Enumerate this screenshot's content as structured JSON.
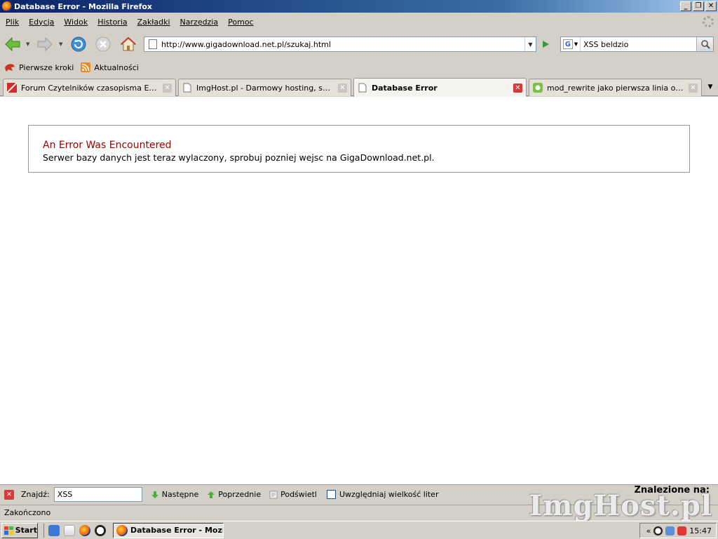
{
  "window": {
    "title": "Database Error - Mozilla Firefox",
    "minimize": "_",
    "maximize": "❐",
    "close": "✕"
  },
  "menu": {
    "items": [
      {
        "label": "Plik"
      },
      {
        "label": "Edycja"
      },
      {
        "label": "Widok"
      },
      {
        "label": "Historia"
      },
      {
        "label": "Zakładki"
      },
      {
        "label": "Narzędzia"
      },
      {
        "label": "Pomoc"
      }
    ]
  },
  "navigation": {
    "url": "http://www.gigadownload.net.pl/szukaj.html",
    "search_value": "XSS beldzio",
    "search_engine_letter": "G"
  },
  "bookmarks": [
    {
      "label": "Pierwsze kroki",
      "icon": "firefox-bookmark-icon"
    },
    {
      "label": "Aktualności",
      "icon": "rss-icon"
    }
  ],
  "tabs": [
    {
      "label": "Forum Czytelników czasopisma Ekspert...",
      "active": false
    },
    {
      "label": "ImgHost.pl - Darmowy hosting, serwer...",
      "active": false
    },
    {
      "label": "Database Error",
      "active": true
    },
    {
      "label": "mod_rewrite jako pierwsza linia obrony...",
      "active": false
    }
  ],
  "page": {
    "error_title": "An Error Was Encountered",
    "error_message": "Serwer bazy danych jest teraz wylaczony, sprobuj pozniej wejsc na GigaDownload.net.pl."
  },
  "findbar": {
    "label": "Znajdź:",
    "value": "XSS",
    "next": "Następne",
    "previous": "Poprzednie",
    "highlight": "Podświetl",
    "match_case": "Uwzględniaj wielkość liter",
    "result": "Znalezione na:"
  },
  "status": {
    "text": "Zakończono"
  },
  "watermark": "ImgHost.pl",
  "taskbar": {
    "start": "Start",
    "task": "Database Error - Mozi...",
    "clock": "15:47",
    "tray_arrow": "«"
  },
  "colors": {
    "error_title": "#990000",
    "titlebar_start": "#0a246a",
    "titlebar_end": "#a6caf0",
    "active_tab_close": "#d43a3a"
  }
}
